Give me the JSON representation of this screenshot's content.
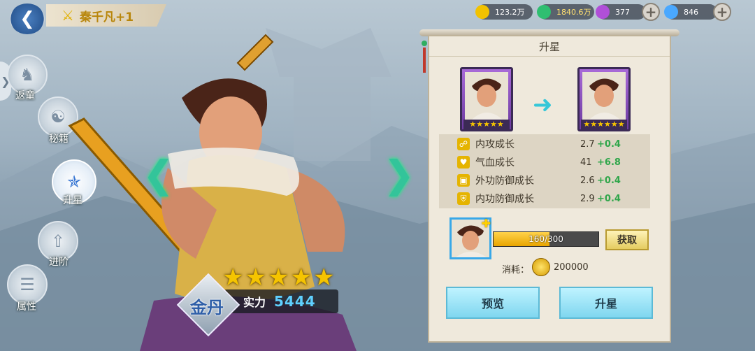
{
  "header": {
    "title": "秦千凡+1"
  },
  "resources": [
    {
      "icon": "gold-coin-icon",
      "value": "123.2万",
      "color": "#f2c200"
    },
    {
      "icon": "green-gem-icon",
      "value": "1840.6万",
      "color": "#2fbf71"
    },
    {
      "icon": "purple-orb-icon",
      "value": "377",
      "color": "#b04fd8"
    },
    {
      "icon": "blue-diamond-icon",
      "value": "846",
      "color": "#4aa8ff"
    }
  ],
  "menu": {
    "items": [
      {
        "label": "返童",
        "icon": "horse-icon"
      },
      {
        "label": "秘籍",
        "icon": "yin-yang-icon"
      },
      {
        "label": "升星",
        "icon": "stars-icon",
        "active": true
      },
      {
        "label": "进阶",
        "icon": "arrow-up-icon"
      },
      {
        "label": "属性",
        "icon": "list-icon"
      }
    ]
  },
  "hero": {
    "stars": 5,
    "rank": "金丹",
    "power_label": "实力",
    "power_value": "5444"
  },
  "panel": {
    "title": "升星",
    "current_stars": 5,
    "next_stars": 6,
    "stats": [
      {
        "name": "内攻成长",
        "value": "2.7",
        "inc": "+0.4",
        "icon": "fist-icon"
      },
      {
        "name": "气血成长",
        "value": "41",
        "inc": "+6.8",
        "icon": "heart-icon"
      },
      {
        "name": "外功防御成长",
        "value": "2.6",
        "inc": "+0.4",
        "icon": "armor-icon"
      },
      {
        "name": "内功防御成长",
        "value": "2.9",
        "inc": "+0.4",
        "icon": "shield-icon"
      }
    ],
    "shard_progress": "160/300",
    "shard_fraction": 0.533,
    "get_label": "获取",
    "cost_label": "消耗：",
    "cost_value": "200000",
    "preview_label": "预览",
    "upgrade_label": "升星"
  }
}
